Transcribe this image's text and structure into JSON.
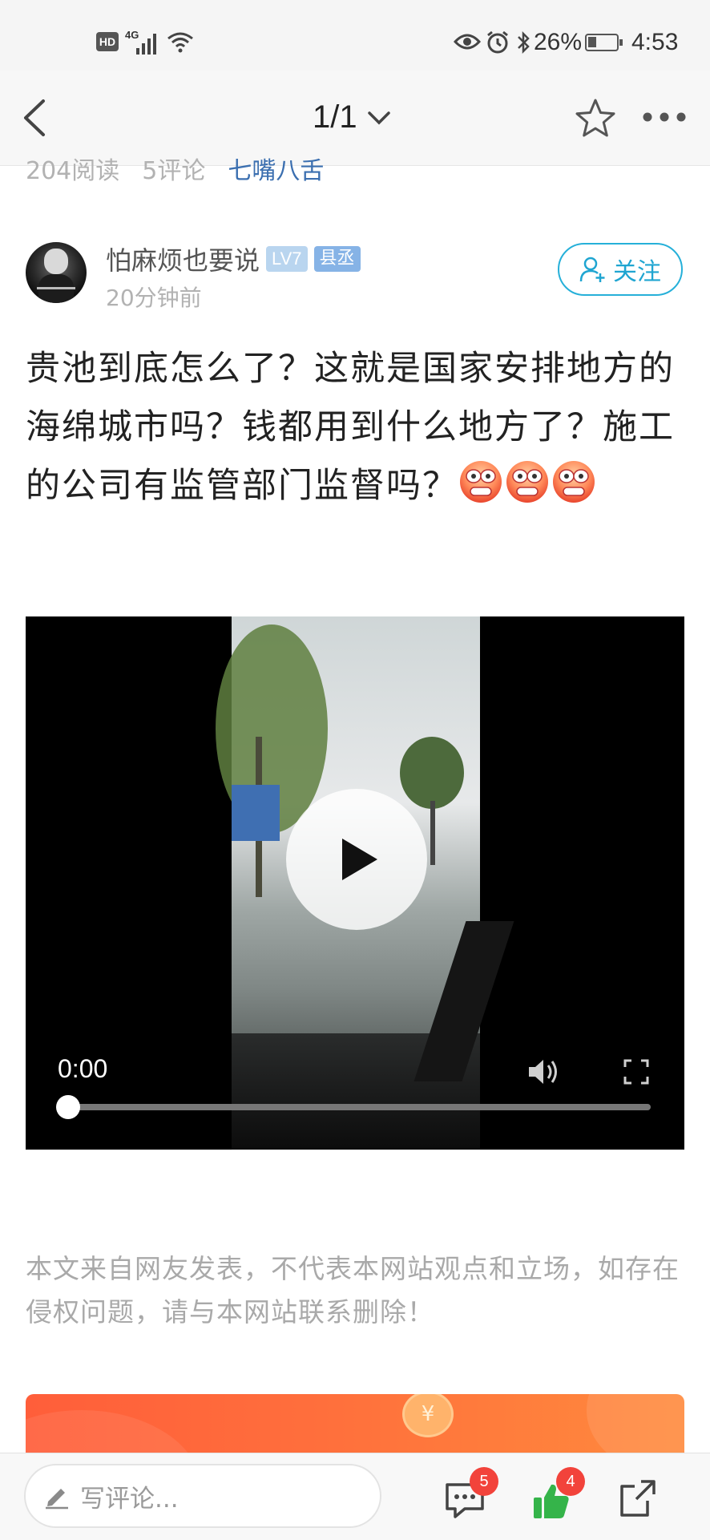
{
  "status_bar": {
    "hd": "HD",
    "network": "4G",
    "battery_percent": "26%",
    "time": "4:53"
  },
  "nav": {
    "page_indicator": "1/1"
  },
  "meta": {
    "reads": "204阅读",
    "comments": "5评论",
    "category": "七嘴八舌"
  },
  "author": {
    "name": "怕麻烦也要说",
    "level": "LV7",
    "title_badge": "县丞",
    "posted_time": "20分钟前",
    "follow_label": "关注"
  },
  "post": {
    "text": "贵池到底怎么了？这就是国家安排地方的海绵城市吗？钱都用到什么地方了？施工的公司有监管部门监督吗？"
  },
  "video": {
    "current_time": "0:00",
    "progress": 0
  },
  "disclaimer": "本文来自网友发表，不代表本网站观点和立场，如存在侵权问题，请与本网站联系删除！",
  "bottom_bar": {
    "comment_placeholder": "写评论...",
    "comment_count": "5",
    "like_count": "4"
  },
  "colors": {
    "accent": "#1fa5d1",
    "like_green": "#35b44a",
    "badge_red": "#f2433b",
    "banner_orange": "#ff6f3c"
  }
}
